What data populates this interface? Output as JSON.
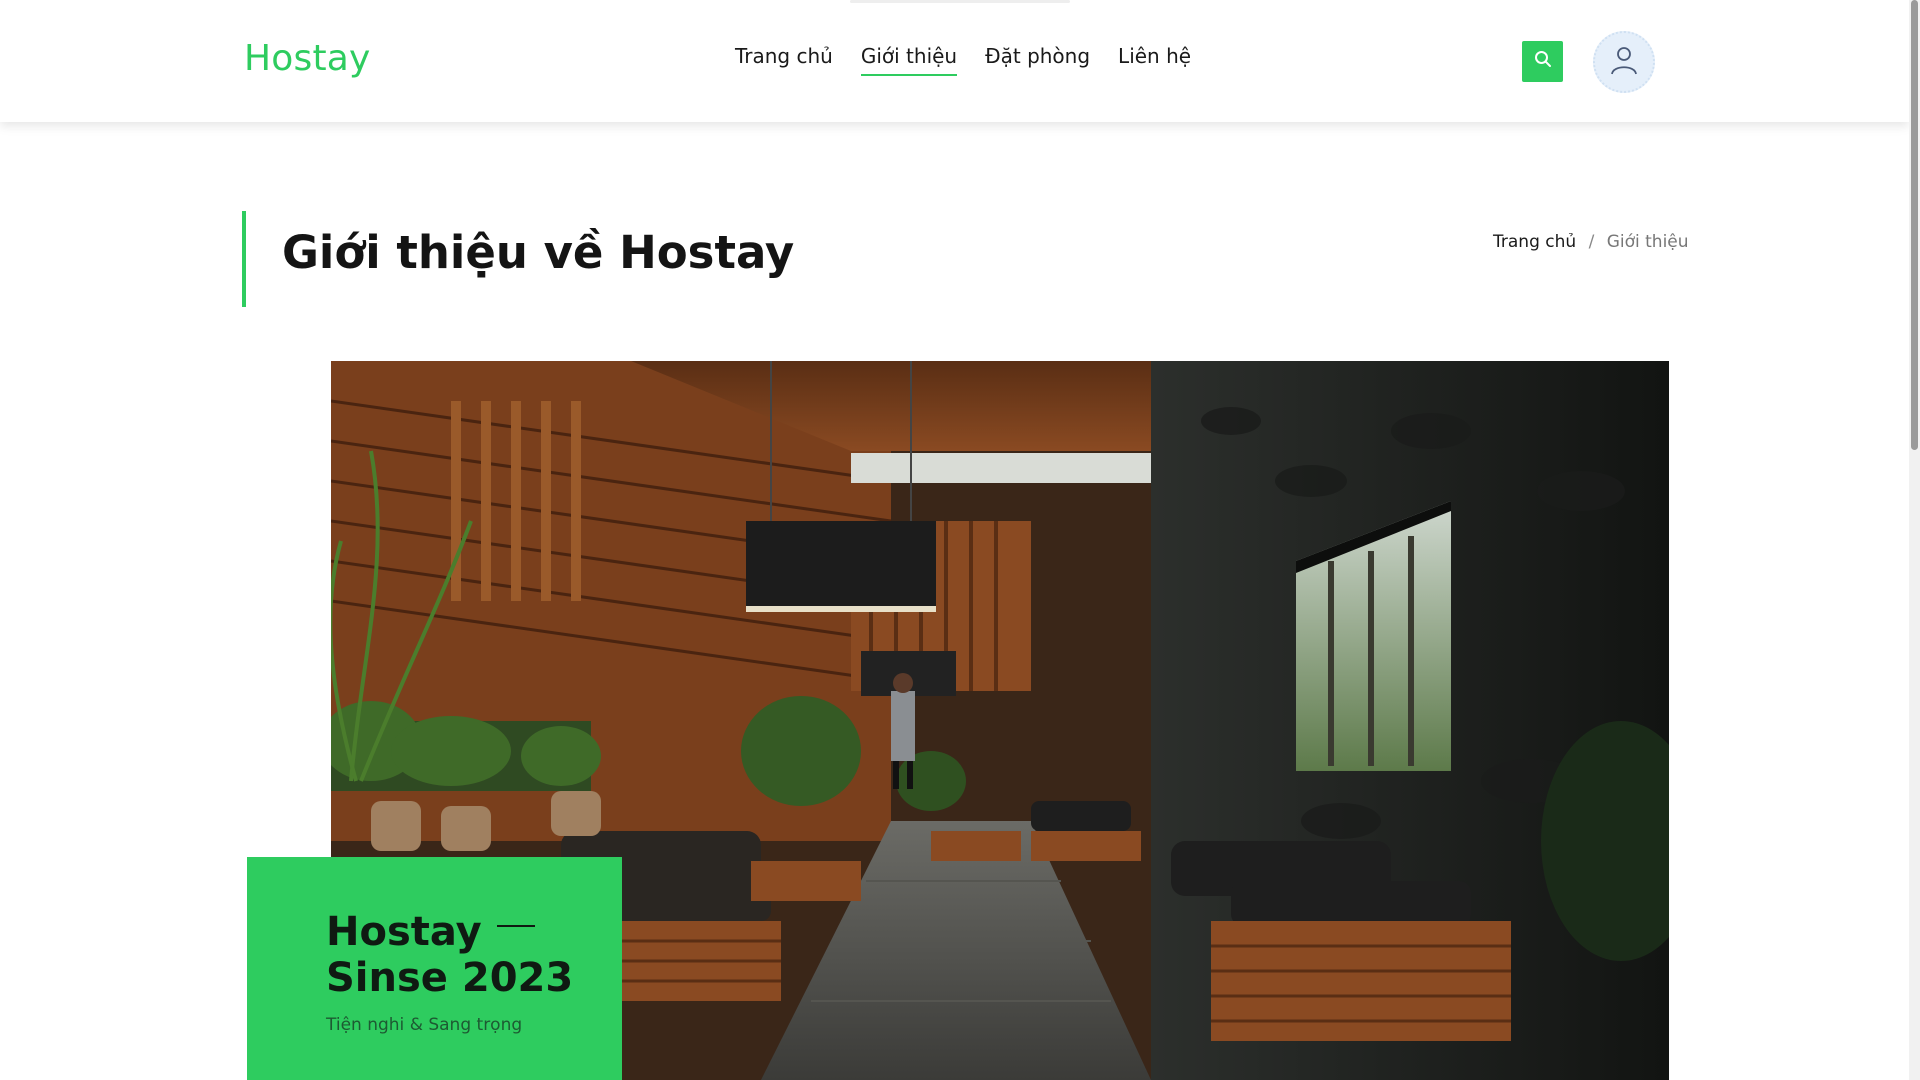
{
  "header": {
    "logo": "Hostay",
    "nav": [
      {
        "label": "Trang chủ",
        "active": false
      },
      {
        "label": "Giới thiệu",
        "active": true
      },
      {
        "label": "Đặt phòng",
        "active": false
      },
      {
        "label": "Liên hệ",
        "active": false
      }
    ],
    "search_icon": "search-icon",
    "avatar_icon": "user-icon"
  },
  "page": {
    "title": "Giới thiệu về Hostay",
    "breadcrumb": {
      "home": "Trang chủ",
      "separator": "/",
      "current": "Giới thiệu"
    }
  },
  "badge": {
    "title_line1": "Hostay",
    "title_line2": "Sinse 2023",
    "subtitle": "Tiện nghi & Sang trọng"
  },
  "colors": {
    "accent": "#2ecc5f",
    "text": "#141414",
    "muted": "#777777"
  }
}
